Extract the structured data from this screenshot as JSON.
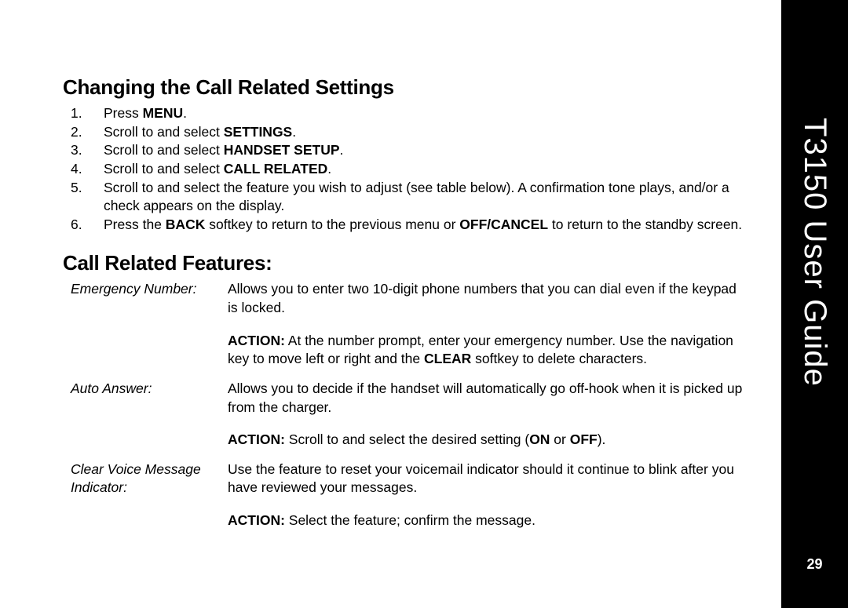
{
  "sidebar": {
    "title": "T3150 User Guide",
    "page": "29"
  },
  "section1": {
    "heading": "Changing the Call Related Settings",
    "step1_a": "Press ",
    "step1_b": "MENU",
    "step1_c": ".",
    "step2_a": "Scroll to and select ",
    "step2_b": "SETTINGS",
    "step2_c": ".",
    "step3_a": "Scroll to and select ",
    "step3_b": "HANDSET SETUP",
    "step3_c": ".",
    "step4_a": "Scroll to and select ",
    "step4_b": "CALL RELATED",
    "step4_c": ".",
    "step5": "Scroll to and select the feature you wish to adjust (see table below). A confirmation tone plays, and/or a check appears on the display.",
    "step6_a": "Press the ",
    "step6_b": "BACK",
    "step6_c": " softkey to return to the previous menu or ",
    "step6_d": "OFF/CANCEL",
    "step6_e": " to return to the standby screen."
  },
  "section2": {
    "heading": "Call Related Features:",
    "f1_label": "Emergency Number:",
    "f1_p1": "Allows you to enter two 10-digit phone numbers that you can dial even if the keypad is locked.",
    "f1_p2_a": "ACTION:",
    "f1_p2_b": " At the number prompt, enter your emergency number. Use the navigation key to move left or right and the ",
    "f1_p2_c": "CLEAR",
    "f1_p2_d": " softkey to delete characters.",
    "f2_label": "Auto Answer:",
    "f2_p1": "Allows you to decide if the handset will automatically go off-hook when it is picked up from the charger.",
    "f2_p2_a": "ACTION:",
    "f2_p2_b": " Scroll to and select the desired setting (",
    "f2_p2_c": "ON",
    "f2_p2_d": " or ",
    "f2_p2_e": "OFF",
    "f2_p2_f": ").",
    "f3_label": "Clear Voice Message Indicator:",
    "f3_p1": "Use the feature to reset your voicemail indicator should it continue to blink after you have reviewed your messages.",
    "f3_p2_a": "ACTION:",
    "f3_p2_b": " Select the feature; confirm the message."
  }
}
